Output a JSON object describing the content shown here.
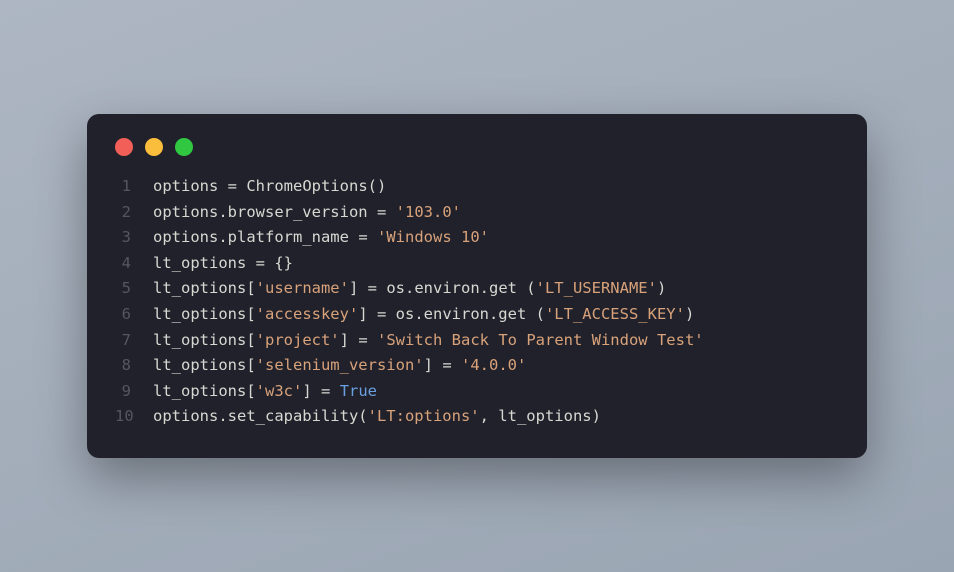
{
  "window": {
    "dots": [
      "red",
      "yellow",
      "green"
    ]
  },
  "code": {
    "lines": [
      {
        "n": "1",
        "tokens": [
          {
            "t": "options ",
            "c": "default"
          },
          {
            "t": "=",
            "c": "punc"
          },
          {
            "t": " ChromeOptions()",
            "c": "default"
          }
        ]
      },
      {
        "n": "2",
        "tokens": [
          {
            "t": "options.browser_version ",
            "c": "default"
          },
          {
            "t": "=",
            "c": "punc"
          },
          {
            "t": " ",
            "c": "default"
          },
          {
            "t": "'103.0'",
            "c": "string"
          }
        ]
      },
      {
        "n": "3",
        "tokens": [
          {
            "t": "options.platform_name ",
            "c": "default"
          },
          {
            "t": "=",
            "c": "punc"
          },
          {
            "t": " ",
            "c": "default"
          },
          {
            "t": "'Windows 10'",
            "c": "string"
          }
        ]
      },
      {
        "n": "4",
        "tokens": [
          {
            "t": "lt_options ",
            "c": "default"
          },
          {
            "t": "=",
            "c": "punc"
          },
          {
            "t": " {}",
            "c": "default"
          }
        ]
      },
      {
        "n": "5",
        "tokens": [
          {
            "t": "lt_options[",
            "c": "default"
          },
          {
            "t": "'username'",
            "c": "string"
          },
          {
            "t": "] ",
            "c": "default"
          },
          {
            "t": "=",
            "c": "punc"
          },
          {
            "t": " os.environ.get (",
            "c": "default"
          },
          {
            "t": "'LT_USERNAME'",
            "c": "string"
          },
          {
            "t": ")",
            "c": "default"
          }
        ]
      },
      {
        "n": "6",
        "tokens": [
          {
            "t": "lt_options[",
            "c": "default"
          },
          {
            "t": "'accesskey'",
            "c": "string"
          },
          {
            "t": "] ",
            "c": "default"
          },
          {
            "t": "=",
            "c": "punc"
          },
          {
            "t": " os.environ.get (",
            "c": "default"
          },
          {
            "t": "'LT_ACCESS_KEY'",
            "c": "string"
          },
          {
            "t": ")",
            "c": "default"
          }
        ]
      },
      {
        "n": "7",
        "tokens": [
          {
            "t": "lt_options[",
            "c": "default"
          },
          {
            "t": "'project'",
            "c": "string"
          },
          {
            "t": "] ",
            "c": "default"
          },
          {
            "t": "=",
            "c": "punc"
          },
          {
            "t": " ",
            "c": "default"
          },
          {
            "t": "'Switch Back To Parent Window Test'",
            "c": "string"
          }
        ]
      },
      {
        "n": "8",
        "tokens": [
          {
            "t": "lt_options[",
            "c": "default"
          },
          {
            "t": "'selenium_version'",
            "c": "string"
          },
          {
            "t": "] ",
            "c": "default"
          },
          {
            "t": "=",
            "c": "punc"
          },
          {
            "t": " ",
            "c": "default"
          },
          {
            "t": "'4.0.0'",
            "c": "string"
          }
        ]
      },
      {
        "n": "9",
        "tokens": [
          {
            "t": "lt_options[",
            "c": "default"
          },
          {
            "t": "'w3c'",
            "c": "string"
          },
          {
            "t": "] ",
            "c": "default"
          },
          {
            "t": "=",
            "c": "punc"
          },
          {
            "t": " ",
            "c": "default"
          },
          {
            "t": "True",
            "c": "const"
          }
        ]
      },
      {
        "n": "10",
        "tokens": [
          {
            "t": "options.set_capability(",
            "c": "default"
          },
          {
            "t": "'LT:options'",
            "c": "string"
          },
          {
            "t": ", lt_options)",
            "c": "default"
          }
        ]
      }
    ]
  }
}
